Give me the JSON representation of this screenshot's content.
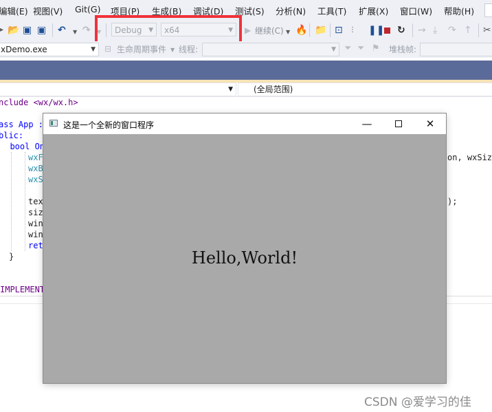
{
  "menu": {
    "items": [
      "编辑(E)",
      "视图(V)",
      "Git(G)",
      "项目(P)",
      "生成(B)",
      "调试(D)",
      "测试(S)",
      "分析(N)",
      "工具(T)",
      "扩展(X)",
      "窗口(W)",
      "帮助(H)"
    ]
  },
  "toolbar": {
    "config_value": "Debug",
    "platform_value": "x64",
    "continue_label": "继续(C)"
  },
  "toolbar2": {
    "process_value": "xDemo.exe",
    "lifecycle_label": "生命周期事件",
    "thread_label": "线程:",
    "stackframe_label": "堆栈帧:"
  },
  "navbar": {
    "scope_value": "(全局范围)"
  },
  "code": {
    "line1": "nclude <wx/wx.h>",
    "line2": "ass App :",
    "line3": "blic:",
    "line4": "  bool On",
    "line5": "wxF",
    "line5_tail": "on, wxSiz",
    "line6": "wxB",
    "line7": "wxS",
    "line8": "tex",
    "line8_tail": ");",
    "line9": "siz",
    "line10": "win",
    "line11": "win",
    "line12": "ret",
    "line13": "}",
    "line14": "IMPLEMENT"
  },
  "window": {
    "title": "这是一个全新的窗口程序",
    "hello_text": "Hello,World!"
  },
  "watermark": "CSDN @爱学习的佳",
  "colors": {
    "highlight": "#f0313a",
    "band": "#5b6b99",
    "window_client": "#a9a9a9"
  }
}
